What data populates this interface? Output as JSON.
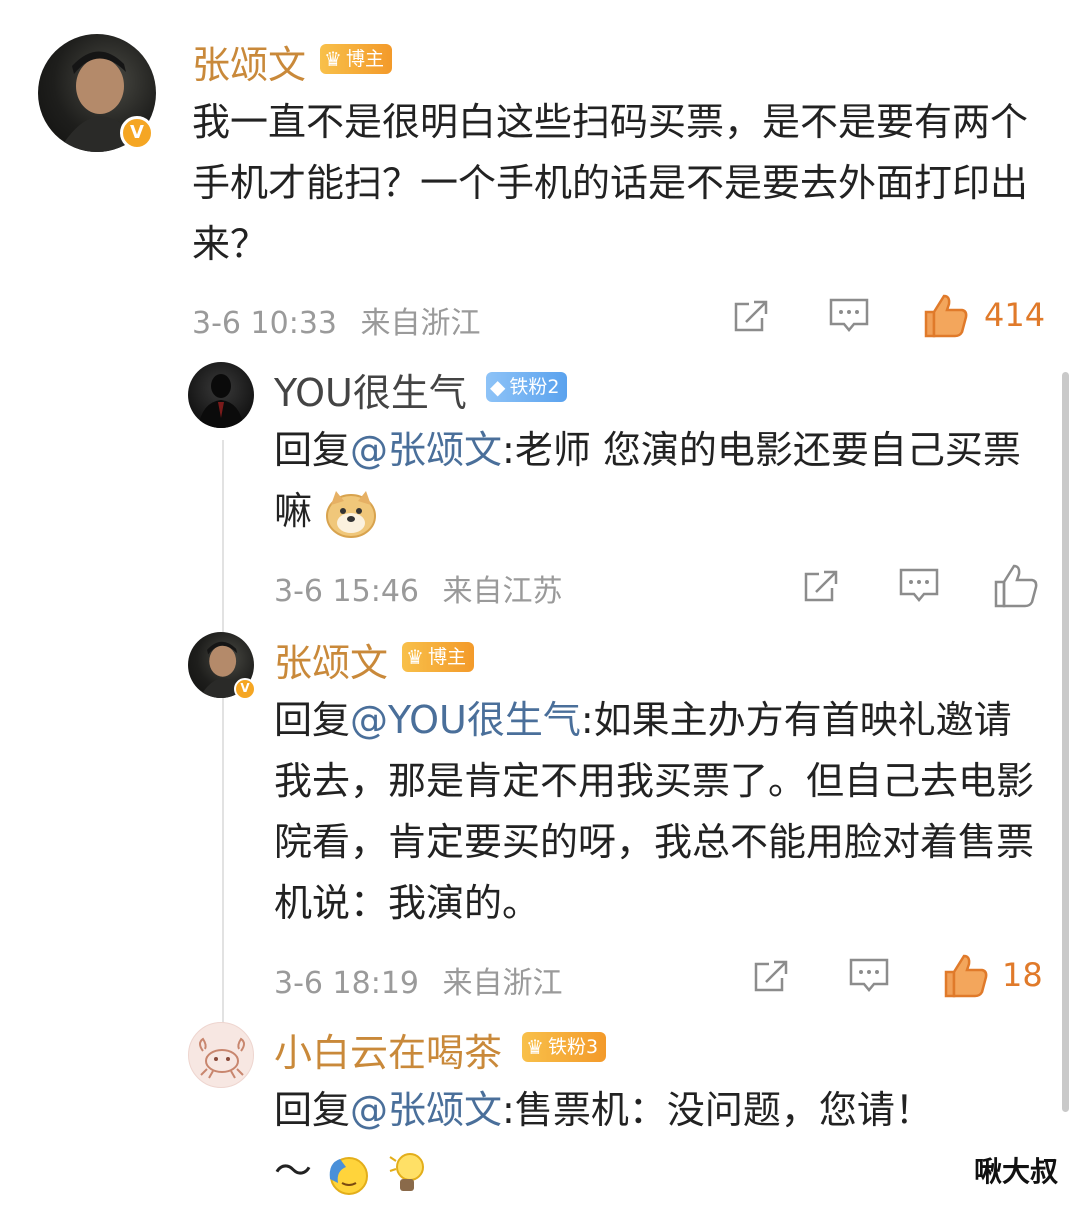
{
  "comments": [
    {
      "author": "张颂文",
      "badge": "博主",
      "text": "我一直不是很明白这些扫码买票，是不是要有两个手机才能扫？一个手机的话是不是要去外面打印出来？",
      "date": "3-6 10:33",
      "location": "来自浙江",
      "likes": "414"
    },
    {
      "author": "YOU很生气",
      "badge": "铁粉2",
      "reply_prefix": "回复",
      "mention": "@张颂文",
      "text": ":老师 您演的电影还要自己买票嘛",
      "emoji": "doge-emoji",
      "date": "3-6 15:46",
      "location": "来自江苏",
      "likes": ""
    },
    {
      "author": "张颂文",
      "badge": "博主",
      "reply_prefix": "回复",
      "mention": "@YOU很生气",
      "text": ":如果主办方有首映礼邀请我去，那是肯定不用我买票了。但自己去电影院看，肯定要买的呀，我总不能用脸对着售票机说：我演的。",
      "date": "3-6 18:19",
      "location": "来自浙江",
      "likes": "18"
    },
    {
      "author": "小白云在喝茶",
      "badge": "铁粉3",
      "reply_prefix": "回复",
      "mention": "@张颂文",
      "text": ":售票机：没问题，您请！",
      "tail": "～",
      "date": "",
      "location": "",
      "likes": ""
    }
  ],
  "watermark": "啾大叔",
  "colors": {
    "author_gold": "#c9893a",
    "mention": "#4a6f9a",
    "like_active": "#e07a2a",
    "meta_gray": "#9a9a9a"
  },
  "icons": {
    "repost": "share-icon",
    "comment": "comment-icon",
    "like": "thumbs-up-icon"
  }
}
